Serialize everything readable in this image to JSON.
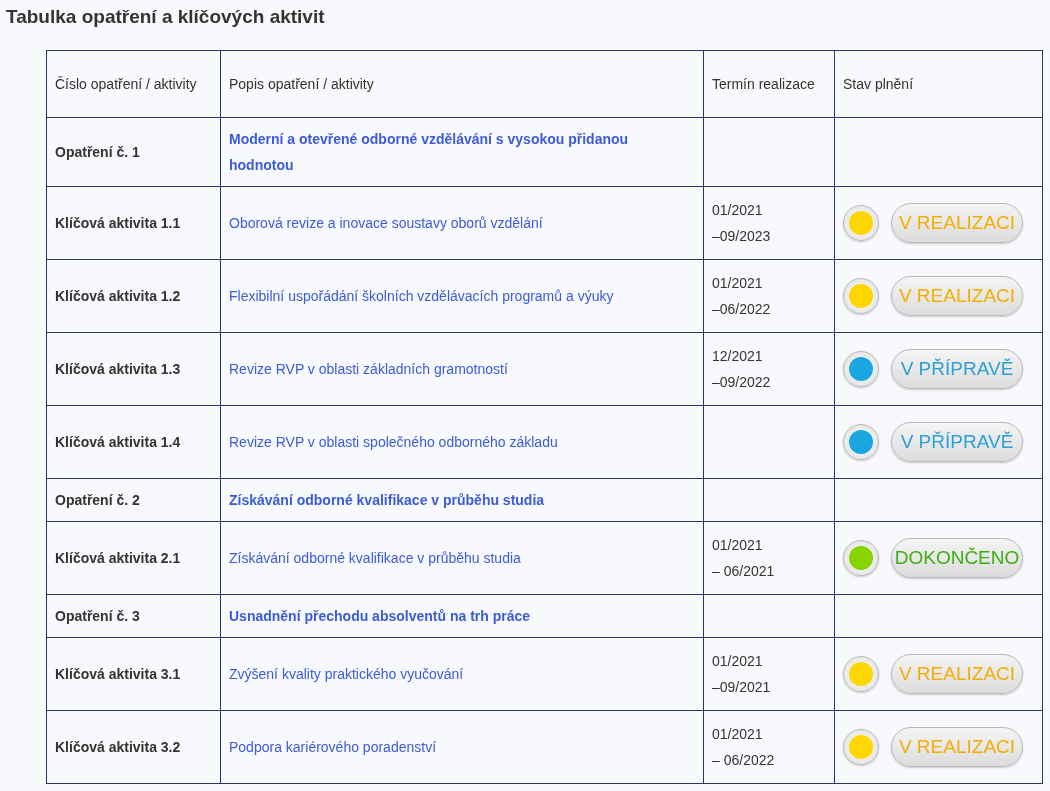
{
  "title": "Tabulka opatření a klíčových aktivit",
  "table": {
    "columns": [
      "Číslo opatření / aktivity",
      "Popis opatření / aktivity",
      "Termín realizace",
      "Stav plnění"
    ],
    "rows": [
      {
        "kind": "measure",
        "number": "Opatření č. 1",
        "description": "Moderní a otevřené odborné vzdělávání s vysokou přidanou hodnotou"
      },
      {
        "kind": "activity",
        "number": "Klíčová aktivita 1.1",
        "description": "Oborová revize a inovace soustavy oborů vzdělání",
        "term": [
          "01/2021",
          "–09/2023"
        ],
        "status": {
          "kind": "in_progress",
          "label": "V REALIZACI",
          "color": "#ffd600"
        }
      },
      {
        "kind": "activity",
        "number": "Klíčová aktivita 1.2",
        "description": "Flexibilní uspořádání školních vzdělávacích programů a výuky",
        "term": [
          "01/2021",
          "–06/2022"
        ],
        "status": {
          "kind": "in_progress",
          "label": "V REALIZACI",
          "color": "#ffd600"
        }
      },
      {
        "kind": "activity",
        "number": "Klíčová aktivita 1.3",
        "description": "Revize RVP v oblasti základních gramotností",
        "term": [
          "12/2021",
          "–09/2022"
        ],
        "status": {
          "kind": "preparing",
          "label": "V PŘÍPRAVĚ",
          "color": "#1aa6e0"
        }
      },
      {
        "kind": "activity",
        "number": "Klíčová aktivita 1.4",
        "description": "Revize RVP v oblasti společného odborného základu",
        "status": {
          "kind": "preparing",
          "label": "V PŘÍPRAVĚ",
          "color": "#1aa6e0"
        }
      },
      {
        "kind": "measure",
        "number": "Opatření č. 2",
        "description": "Získávání odborné kvalifikace v průběhu studia"
      },
      {
        "kind": "activity",
        "number": "Klíčová aktivita 2.1",
        "description": "Získávání odborné kvalifikace v průběhu studia",
        "term": [
          "01/2021",
          "– 06/2021"
        ],
        "status": {
          "kind": "done",
          "label": "DOKONČENO",
          "color": "#88d400"
        }
      },
      {
        "kind": "measure",
        "number": "Opatření č. 3",
        "description": "Usnadnění přechodu absolventů na trh práce"
      },
      {
        "kind": "activity",
        "number": "Klíčová aktivita 3.1",
        "description": "Zvýšení kvality praktického vyučování",
        "term": [
          "01/2021",
          "–09/2021"
        ],
        "status": {
          "kind": "in_progress",
          "label": "V REALIZACI",
          "color": "#ffd600"
        }
      },
      {
        "kind": "activity",
        "number": "Klíčová aktivita 3.2",
        "description": "Podpora kariérového poradenství",
        "term": [
          "01/2021",
          "– 06/2022"
        ],
        "status": {
          "kind": "in_progress",
          "label": "V REALIZACI",
          "color": "#ffd600"
        }
      }
    ]
  }
}
